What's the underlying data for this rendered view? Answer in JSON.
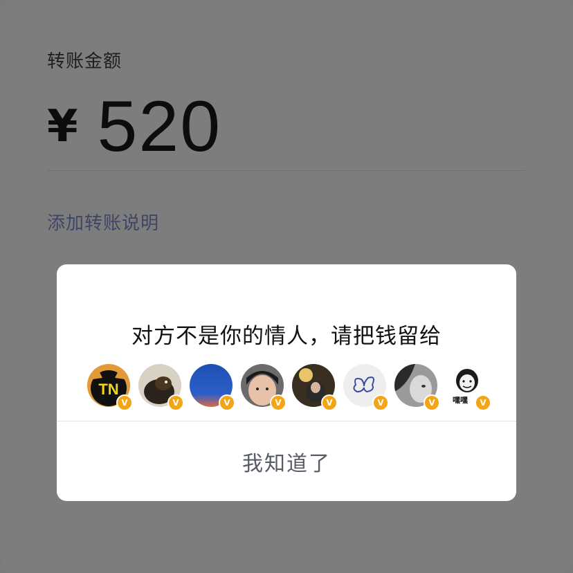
{
  "transfer": {
    "amount_label": "转账金额",
    "currency_symbol": "¥",
    "amount": "520",
    "add_note_label": "添加转账说明"
  },
  "dialog": {
    "message": "对方不是你的情人，请把钱留给",
    "confirm_label": "我知道了",
    "avatars": [
      {
        "name": "avatar-tiger-icon",
        "badge": "V"
      },
      {
        "name": "avatar-dog-icon",
        "badge": "V"
      },
      {
        "name": "avatar-sky-icon",
        "badge": "V"
      },
      {
        "name": "avatar-boy-icon",
        "badge": "V"
      },
      {
        "name": "avatar-girl-icon",
        "badge": "V"
      },
      {
        "name": "avatar-butterfly-icon",
        "badge": "V"
      },
      {
        "name": "avatar-person-icon",
        "badge": "V"
      },
      {
        "name": "avatar-meme-icon",
        "badge": "V",
        "caption": "嘿嘿"
      }
    ]
  },
  "colors": {
    "overlay": "#7d7d7d",
    "note_link": "#3f4564",
    "badge": "#f2a516",
    "confirm_text": "#575b64"
  }
}
